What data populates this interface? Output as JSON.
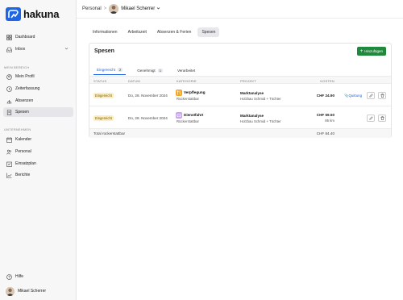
{
  "app": {
    "name": "hakuna"
  },
  "sidebar": {
    "top_items": [
      {
        "label": "Dashboard"
      },
      {
        "label": "Inbox"
      }
    ],
    "section_mine": "MEIN BEREICH",
    "mine_items": [
      {
        "label": "Mein Profil"
      },
      {
        "label": "Zeiterfassung"
      },
      {
        "label": "Absenzen"
      },
      {
        "label": "Spesen"
      }
    ],
    "section_company": "UNTERNEHMEN",
    "company_items": [
      {
        "label": "Kalender"
      },
      {
        "label": "Personal"
      },
      {
        "label": "Einsatzplan"
      },
      {
        "label": "Berichte"
      }
    ],
    "help": "Hilfe",
    "user": "Mikael Scherrer"
  },
  "topbar": {
    "crumb_root": "Personal",
    "crumb_sep": ">",
    "person": "Mikael Scherrer"
  },
  "tabs": [
    {
      "label": "Informationen"
    },
    {
      "label": "Arbeitszeit"
    },
    {
      "label": "Absenzen & Ferien"
    },
    {
      "label": "Spesen"
    }
  ],
  "card": {
    "title": "Spesen",
    "add_label": "Hinzufügen",
    "subtabs": [
      {
        "label": "Eingereicht",
        "count": "2"
      },
      {
        "label": "Genehmigt",
        "count": "1"
      },
      {
        "label": "Verarbeitet",
        "count": ""
      }
    ],
    "headers": {
      "status": "STATUS",
      "date": "DATUM",
      "category": "KATEGORIE",
      "project": "PROJEKT",
      "cost": "KOSTEN"
    },
    "rows": [
      {
        "status": "Eingereicht",
        "date": "Do, 28. November 2024",
        "category": "Verpflegung",
        "category_sub": "Rückerstattbar",
        "project": "Marktanalyse",
        "project_sub": "Holzbau Schmid + Töchter",
        "amount": "CHF 24.90",
        "receipt": "Quittung"
      },
      {
        "status": "Eingereicht",
        "date": "Do, 28. November 2024",
        "category": "Dienstfahrt",
        "category_sub": "Rückerstattbar",
        "project": "Marktanalyse",
        "project_sub": "Holzbau Schmid + Töchter",
        "amount": "CHF 59.50",
        "km": "85 km"
      }
    ],
    "total_label": "Total rückerstattbar",
    "total_value": "CHF 84.40"
  },
  "colors": {
    "accent": "#1d66e5",
    "add_button": "#1f8a3c",
    "status_badge": "#fdeec0",
    "food_icon": "#f5a623",
    "car_icon": "#c7a4f0"
  }
}
